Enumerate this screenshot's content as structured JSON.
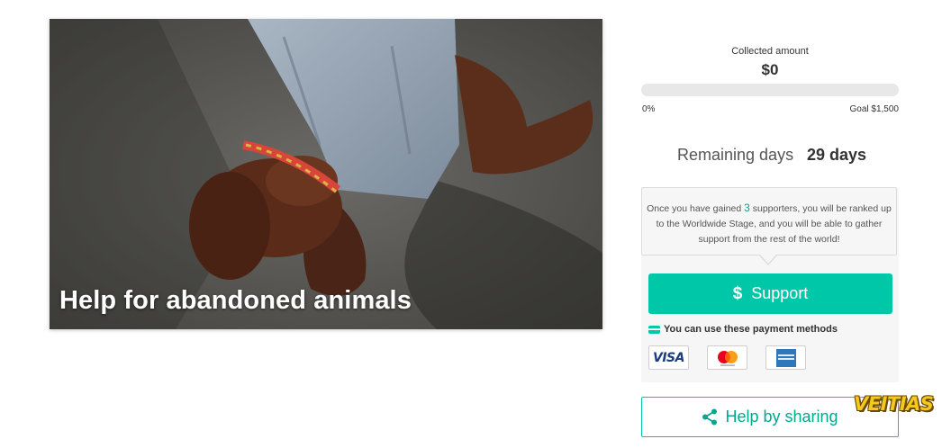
{
  "campaign": {
    "title": "Help for abandoned animals"
  },
  "funding": {
    "collected_label": "Collected amount",
    "collected_value": "$0",
    "progress_fraction": 0,
    "percent_text": "0%",
    "goal_text": "Goal $1,500"
  },
  "remaining": {
    "label": "Remaining days",
    "value": "29 days"
  },
  "info": {
    "text_before": "Once you have gained ",
    "supporters_count": "3",
    "text_after": " supporters, you will be ranked up to the Worldwide Stage, and you will be able to gather support from the rest of the world!"
  },
  "support_button": {
    "icon": "$",
    "label": "Support"
  },
  "payment": {
    "label": "You can use these payment methods",
    "methods": [
      "VISA",
      "mastercard",
      "american-express"
    ]
  },
  "share_button": {
    "label": "Help by sharing",
    "icon": "share-icon"
  },
  "watermark": "VEITIAS",
  "colors": {
    "accent": "#00c7a8",
    "accent_text": "#00a88f"
  }
}
